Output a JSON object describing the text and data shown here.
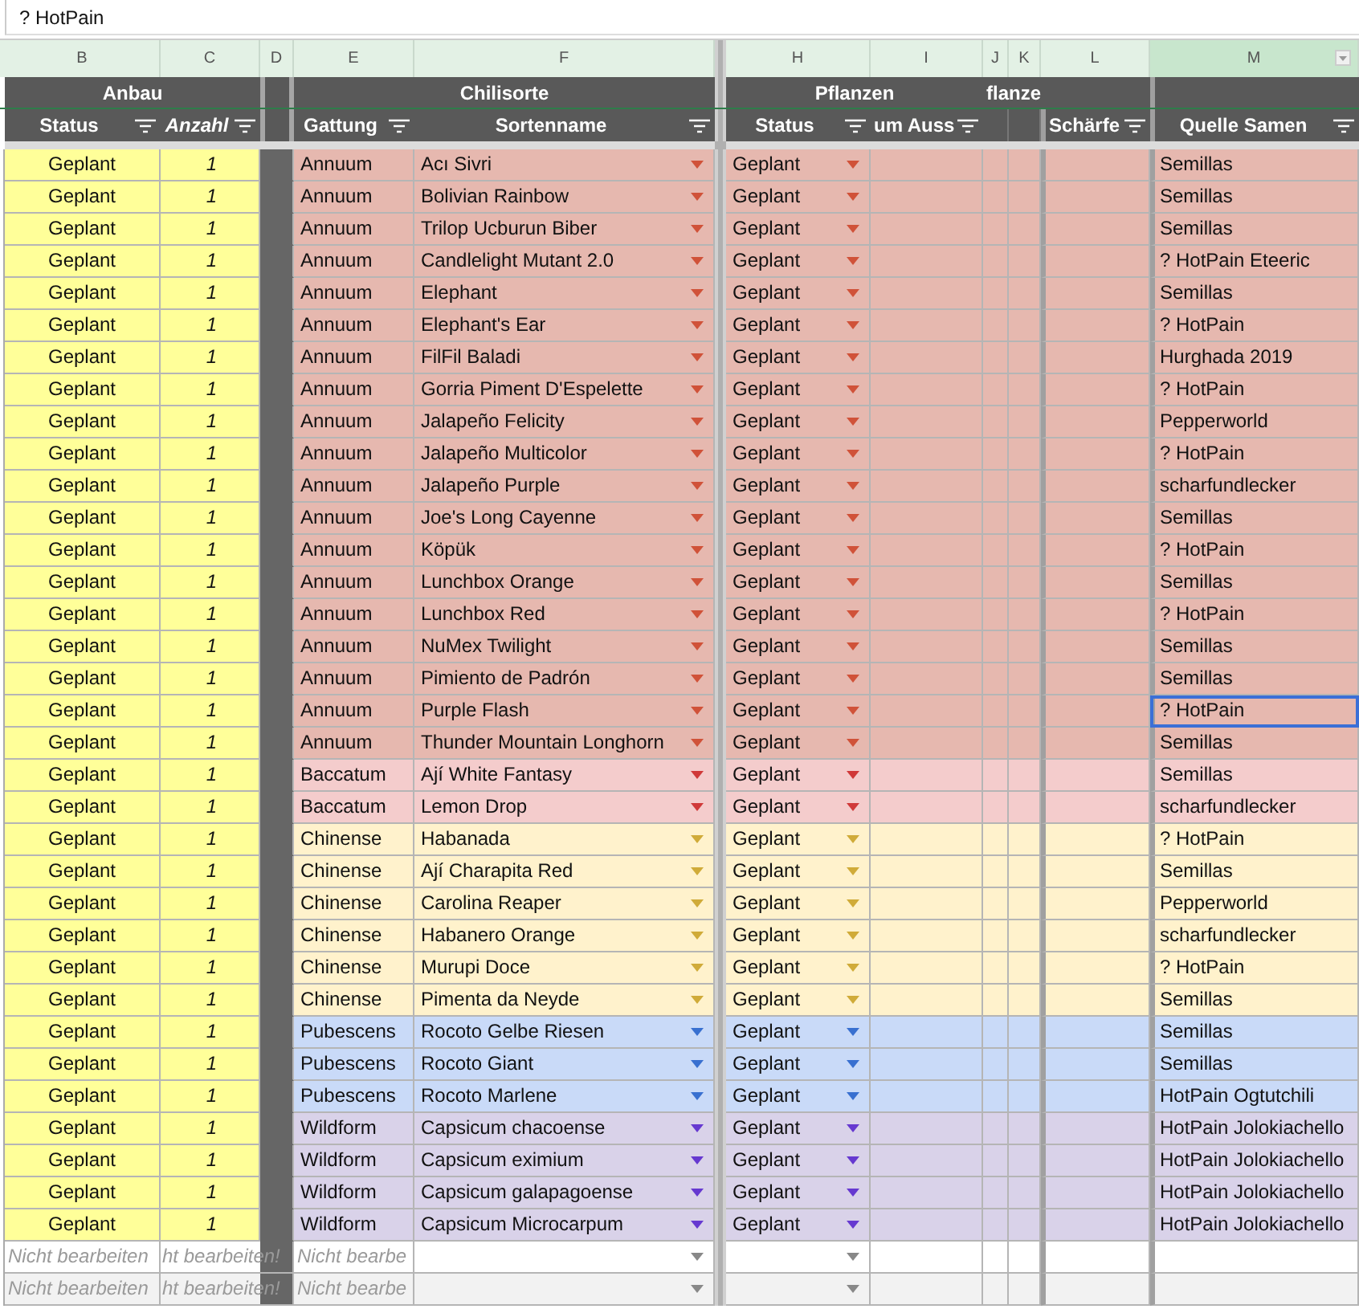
{
  "formula_bar": {
    "value": "? HotPain"
  },
  "columns": [
    {
      "letter": "B",
      "selected": false
    },
    {
      "letter": "C",
      "selected": false
    },
    {
      "letter": "D",
      "selected": false
    },
    {
      "letter": "E",
      "selected": false
    },
    {
      "letter": "F",
      "selected": false
    },
    {
      "letter": "H",
      "selected": false
    },
    {
      "letter": "I",
      "selected": false
    },
    {
      "letter": "J",
      "selected": false
    },
    {
      "letter": "K",
      "selected": false
    },
    {
      "letter": "L",
      "selected": false
    },
    {
      "letter": "M",
      "selected": true
    }
  ],
  "groups": [
    {
      "label": "Anbau"
    },
    {
      "label": "Chilisorte"
    },
    {
      "label": "Pflanzen"
    },
    {
      "label": "flanze"
    }
  ],
  "headers": [
    {
      "label": "Status",
      "italic": false
    },
    {
      "label": "Anzahl",
      "italic": true
    },
    {
      "label": "Gattung",
      "italic": false
    },
    {
      "label": "Sortenname",
      "italic": false
    },
    {
      "label": "Status",
      "italic": false
    },
    {
      "label": "um Auss",
      "italic": false
    },
    {
      "label": "Schärfe",
      "italic": false
    },
    {
      "label": "Quelle Samen",
      "italic": false
    }
  ],
  "rows": [
    {
      "kind": "entry",
      "status": "Geplant",
      "count": "1",
      "genus": "Annuum",
      "variety": "Acı Sivri",
      "plant_status": "Geplant",
      "source": "Semillas",
      "color": "#e6b8af",
      "selected": false
    },
    {
      "kind": "entry",
      "status": "Geplant",
      "count": "1",
      "genus": "Annuum",
      "variety": "Bolivian Rainbow",
      "plant_status": "Geplant",
      "source": "Semillas",
      "color": "#e6b8af",
      "selected": false
    },
    {
      "kind": "entry",
      "status": "Geplant",
      "count": "1",
      "genus": "Annuum",
      "variety": "Trilop Ucburun Biber",
      "plant_status": "Geplant",
      "source": "Semillas",
      "color": "#e6b8af",
      "selected": false
    },
    {
      "kind": "entry",
      "status": "Geplant",
      "count": "1",
      "genus": "Annuum",
      "variety": "Candlelight Mutant 2.0",
      "plant_status": "Geplant",
      "source": "? HotPain Eteeric",
      "color": "#e6b8af",
      "selected": false
    },
    {
      "kind": "entry",
      "status": "Geplant",
      "count": "1",
      "genus": "Annuum",
      "variety": "Elephant",
      "plant_status": "Geplant",
      "source": "Semillas",
      "color": "#e6b8af",
      "selected": false
    },
    {
      "kind": "entry",
      "status": "Geplant",
      "count": "1",
      "genus": "Annuum",
      "variety": "Elephant's Ear",
      "plant_status": "Geplant",
      "source": "? HotPain",
      "color": "#e6b8af",
      "selected": false
    },
    {
      "kind": "entry",
      "status": "Geplant",
      "count": "1",
      "genus": "Annuum",
      "variety": "FilFil Baladi",
      "plant_status": "Geplant",
      "source": "Hurghada 2019",
      "color": "#e6b8af",
      "selected": false
    },
    {
      "kind": "entry",
      "status": "Geplant",
      "count": "1",
      "genus": "Annuum",
      "variety": "Gorria Piment D'Espelette",
      "plant_status": "Geplant",
      "source": "? HotPain",
      "color": "#e6b8af",
      "selected": false
    },
    {
      "kind": "entry",
      "status": "Geplant",
      "count": "1",
      "genus": "Annuum",
      "variety": "Jalapeño Felicity",
      "plant_status": "Geplant",
      "source": "Pepperworld",
      "color": "#e6b8af",
      "selected": false
    },
    {
      "kind": "entry",
      "status": "Geplant",
      "count": "1",
      "genus": "Annuum",
      "variety": "Jalapeño Multicolor",
      "plant_status": "Geplant",
      "source": "? HotPain",
      "color": "#e6b8af",
      "selected": false
    },
    {
      "kind": "entry",
      "status": "Geplant",
      "count": "1",
      "genus": "Annuum",
      "variety": "Jalapeño Purple",
      "plant_status": "Geplant",
      "source": "scharfundlecker",
      "color": "#e6b8af",
      "selected": false
    },
    {
      "kind": "entry",
      "status": "Geplant",
      "count": "1",
      "genus": "Annuum",
      "variety": "Joe's Long Cayenne",
      "plant_status": "Geplant",
      "source": "Semillas",
      "color": "#e6b8af",
      "selected": false
    },
    {
      "kind": "entry",
      "status": "Geplant",
      "count": "1",
      "genus": "Annuum",
      "variety": "Köpük",
      "plant_status": "Geplant",
      "source": "? HotPain",
      "color": "#e6b8af",
      "selected": false
    },
    {
      "kind": "entry",
      "status": "Geplant",
      "count": "1",
      "genus": "Annuum",
      "variety": "Lunchbox Orange",
      "plant_status": "Geplant",
      "source": "Semillas",
      "color": "#e6b8af",
      "selected": false
    },
    {
      "kind": "entry",
      "status": "Geplant",
      "count": "1",
      "genus": "Annuum",
      "variety": "Lunchbox Red",
      "plant_status": "Geplant",
      "source": "? HotPain",
      "color": "#e6b8af",
      "selected": false
    },
    {
      "kind": "entry",
      "status": "Geplant",
      "count": "1",
      "genus": "Annuum",
      "variety": "NuMex Twilight",
      "plant_status": "Geplant",
      "source": "Semillas",
      "color": "#e6b8af",
      "selected": false
    },
    {
      "kind": "entry",
      "status": "Geplant",
      "count": "1",
      "genus": "Annuum",
      "variety": "Pimiento de Padrón",
      "plant_status": "Geplant",
      "source": "Semillas",
      "color": "#e6b8af",
      "selected": false
    },
    {
      "kind": "entry",
      "status": "Geplant",
      "count": "1",
      "genus": "Annuum",
      "variety": "Purple Flash",
      "plant_status": "Geplant",
      "source": "? HotPain",
      "color": "#e6b8af",
      "selected": true
    },
    {
      "kind": "entry",
      "status": "Geplant",
      "count": "1",
      "genus": "Annuum",
      "variety": "Thunder Mountain Longhorn",
      "plant_status": "Geplant",
      "source": "Semillas",
      "color": "#e6b8af",
      "selected": false
    },
    {
      "kind": "entry",
      "status": "Geplant",
      "count": "1",
      "genus": "Baccatum",
      "variety": "Ají White Fantasy",
      "plant_status": "Geplant",
      "source": "Semillas",
      "color": "#f4cccc",
      "selected": false
    },
    {
      "kind": "entry",
      "status": "Geplant",
      "count": "1",
      "genus": "Baccatum",
      "variety": "Lemon Drop",
      "plant_status": "Geplant",
      "source": "scharfundlecker",
      "color": "#f4cccc",
      "selected": false
    },
    {
      "kind": "entry",
      "status": "Geplant",
      "count": "1",
      "genus": "Chinense",
      "variety": "Habanada",
      "plant_status": "Geplant",
      "source": "? HotPain",
      "color": "#fff2cc",
      "selected": false
    },
    {
      "kind": "entry",
      "status": "Geplant",
      "count": "1",
      "genus": "Chinense",
      "variety": "Ají Charapita Red",
      "plant_status": "Geplant",
      "source": "Semillas",
      "color": "#fff2cc",
      "selected": false
    },
    {
      "kind": "entry",
      "status": "Geplant",
      "count": "1",
      "genus": "Chinense",
      "variety": "Carolina Reaper",
      "plant_status": "Geplant",
      "source": "Pepperworld",
      "color": "#fff2cc",
      "selected": false
    },
    {
      "kind": "entry",
      "status": "Geplant",
      "count": "1",
      "genus": "Chinense",
      "variety": "Habanero Orange",
      "plant_status": "Geplant",
      "source": "scharfundlecker",
      "color": "#fff2cc",
      "selected": false
    },
    {
      "kind": "entry",
      "status": "Geplant",
      "count": "1",
      "genus": "Chinense",
      "variety": "Murupi Doce",
      "plant_status": "Geplant",
      "source": "? HotPain",
      "color": "#fff2cc",
      "selected": false
    },
    {
      "kind": "entry",
      "status": "Geplant",
      "count": "1",
      "genus": "Chinense",
      "variety": "Pimenta da Neyde",
      "plant_status": "Geplant",
      "source": "Semillas",
      "color": "#fff2cc",
      "selected": false
    },
    {
      "kind": "entry",
      "status": "Geplant",
      "count": "1",
      "genus": "Pubescens",
      "variety": "Rocoto Gelbe Riesen",
      "plant_status": "Geplant",
      "source": "Semillas",
      "color": "#c9daf8",
      "selected": false
    },
    {
      "kind": "entry",
      "status": "Geplant",
      "count": "1",
      "genus": "Pubescens",
      "variety": "Rocoto Giant",
      "plant_status": "Geplant",
      "source": "Semillas",
      "color": "#c9daf8",
      "selected": false
    },
    {
      "kind": "entry",
      "status": "Geplant",
      "count": "1",
      "genus": "Pubescens",
      "variety": "Rocoto Marlene",
      "plant_status": "Geplant",
      "source": "HotPain Ogtutchili",
      "color": "#c9daf8",
      "selected": false
    },
    {
      "kind": "entry",
      "status": "Geplant",
      "count": "1",
      "genus": "Wildform",
      "variety": "Capsicum chacoense",
      "plant_status": "Geplant",
      "source": "HotPain Jolokiachello",
      "color": "#d9d2e9",
      "selected": false
    },
    {
      "kind": "entry",
      "status": "Geplant",
      "count": "1",
      "genus": "Wildform",
      "variety": "Capsicum eximium",
      "plant_status": "Geplant",
      "source": "HotPain Jolokiachello",
      "color": "#d9d2e9",
      "selected": false
    },
    {
      "kind": "entry",
      "status": "Geplant",
      "count": "1",
      "genus": "Wildform",
      "variety": "Capsicum galapagoense",
      "plant_status": "Geplant",
      "source": "HotPain Jolokiachello",
      "color": "#d9d2e9",
      "selected": false
    },
    {
      "kind": "entry",
      "status": "Geplant",
      "count": "1",
      "genus": "Wildform",
      "variety": "Capsicum Microcarpum",
      "plant_status": "Geplant",
      "source": "HotPain Jolokiachello",
      "color": "#d9d2e9",
      "selected": false
    },
    {
      "kind": "blank",
      "status": "Nicht bearbeiten",
      "count": "ht bearbeiten!",
      "genus": "Nicht bearbe"
    },
    {
      "kind": "blank",
      "status": "Nicht bearbeiten",
      "count": "ht bearbeiten!",
      "genus": "Nicht bearbe"
    }
  ]
}
